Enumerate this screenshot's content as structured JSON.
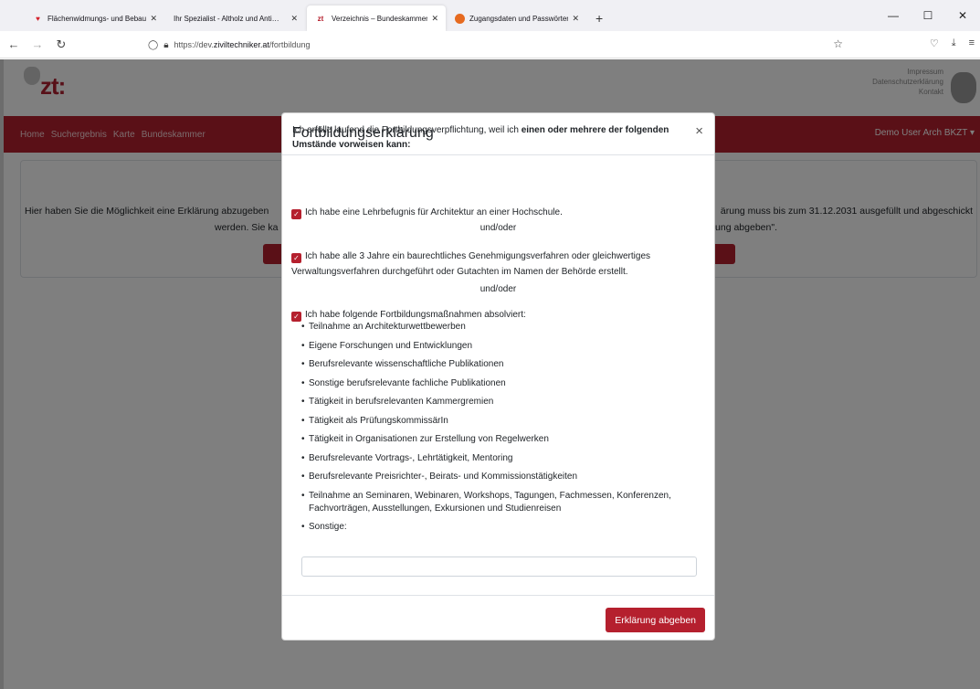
{
  "browser": {
    "tabs": [
      {
        "title": "Flächenwidmungs- und Bebau…",
        "icon": "wien-icon",
        "active": false
      },
      {
        "title": "Ihr Spezialist - Altholz und Anti…",
        "icon": "",
        "active": false
      },
      {
        "title": "Verzeichnis – Bundeskammer d…",
        "icon": "zt-icon",
        "active": true
      },
      {
        "title": "Zugangsdaten und Passwörter",
        "icon": "firefox-icon",
        "active": false
      }
    ],
    "new_tab": "+",
    "url_prefix": "https://dev.",
    "url_host": "ziviltechniker.at",
    "url_path": "/fortbildung"
  },
  "header": {
    "logo_text": "zt:",
    "links": [
      "Impressum",
      "Datenschutzerklärung",
      "Kontakt"
    ]
  },
  "nav": {
    "items": [
      "Home",
      "Suchergebnis",
      "Karte",
      "Bundeskammer"
    ],
    "user": "Demo User Arch BKZT ▾"
  },
  "card": {
    "line1_left": "Hier haben Sie die Möglichkeit eine Erklärung abzugeben",
    "line1_right": "ärung muss bis zum 31.12.2031 ausgefüllt und abgeschickt",
    "line2_left": "werden. Sie ka",
    "line2_right": "ung abgeben\"."
  },
  "modal": {
    "title": "Fortbildungserklärung",
    "close": "×",
    "intro_plain": "Ich erfülle laufend die Fortbildungsverpflichtung, weil ich ",
    "intro_bold": "einen oder mehrere der folgenden Umstände vorweisen kann:",
    "option1": "Ich habe eine Lehrbefugnis für Architektur an einer Hochschule.",
    "andor": "und/oder",
    "option2": "Ich habe alle 3 Jahre ein baurechtliches Genehmigungsverfahren oder gleichwertiges Verwaltungsverfahren durchgeführt oder Gutachten im Namen der Behörde erstellt.",
    "option3": "Ich habe folgende Fortbildungsmaßnahmen absolviert:",
    "measures": [
      "Teilnahme an Architekturwettbewerben",
      "Eigene Forschungen und Entwicklungen",
      "Berufsrelevante wissenschaftliche Publikationen",
      "Sonstige berufsrelevante fachliche Publikationen",
      "Tätigkeit in berufsrelevanten Kammergremien",
      "Tätigkeit als PrüfungskommissärIn",
      "Tätigkeit in Organisationen zur Erstellung von Regelwerken",
      "Berufsrelevante Vortrags-, Lehrtätigkeit, Mentoring",
      "Berufsrelevante Preisrichter-, Beirats- und Kommissionstätigkeiten",
      "Teilnahme an Seminaren, Webinaren, Workshops, Tagungen, Fachmessen, Konferenzen, Fachvorträgen, Ausstellungen, Exkursionen und Studienreisen",
      "Sonstige:"
    ],
    "other_value": "",
    "submit_label": "Erklärung abgeben"
  },
  "colors": {
    "brand": "#b5202e"
  }
}
